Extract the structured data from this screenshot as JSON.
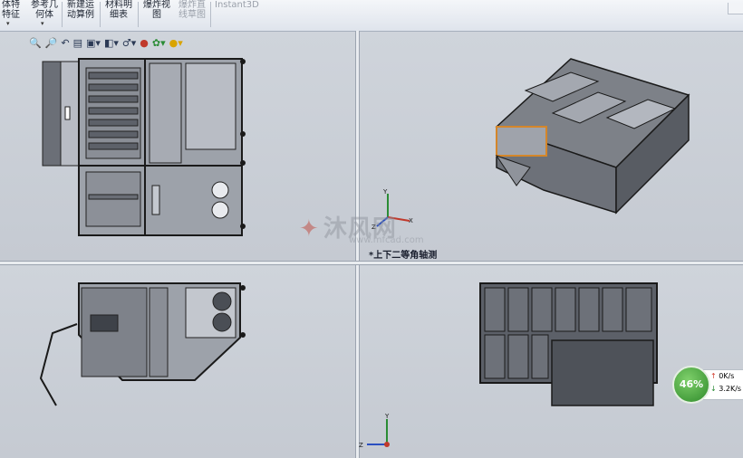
{
  "ribbon": {
    "buttons": [
      {
        "label": "体特\n特征",
        "disabled": false
      },
      {
        "label": "参考几\n何体",
        "disabled": false
      },
      {
        "label": "新建运\n动算例",
        "disabled": false
      },
      {
        "label": "材料明\n细表",
        "disabled": false
      },
      {
        "label": "爆炸视\n图",
        "disabled": false
      },
      {
        "label": "爆炸直\n线草图",
        "disabled": true
      },
      {
        "label": "Instant3D",
        "disabled": true
      }
    ]
  },
  "view_toolbar": {
    "icons": [
      "zoom-to-fit-icon",
      "zoom-area-icon",
      "previous-view-icon",
      "section-view-icon",
      "view-orientation-icon",
      "display-style-icon",
      "hide-show-icon",
      "edit-appearance-icon",
      "apply-scene-icon",
      "view-settings-icon"
    ]
  },
  "viewports": {
    "top_right_label": "*上下二等角轴测",
    "triad_labels": {
      "x": "X",
      "y": "Y",
      "z": "Z"
    }
  },
  "watermark": {
    "text": "沐风网",
    "url": "www.mfcad.com"
  },
  "net_widget": {
    "percent": "46%",
    "upload": "0K/s",
    "download": "3.2K/s",
    "percent_value": 46
  }
}
